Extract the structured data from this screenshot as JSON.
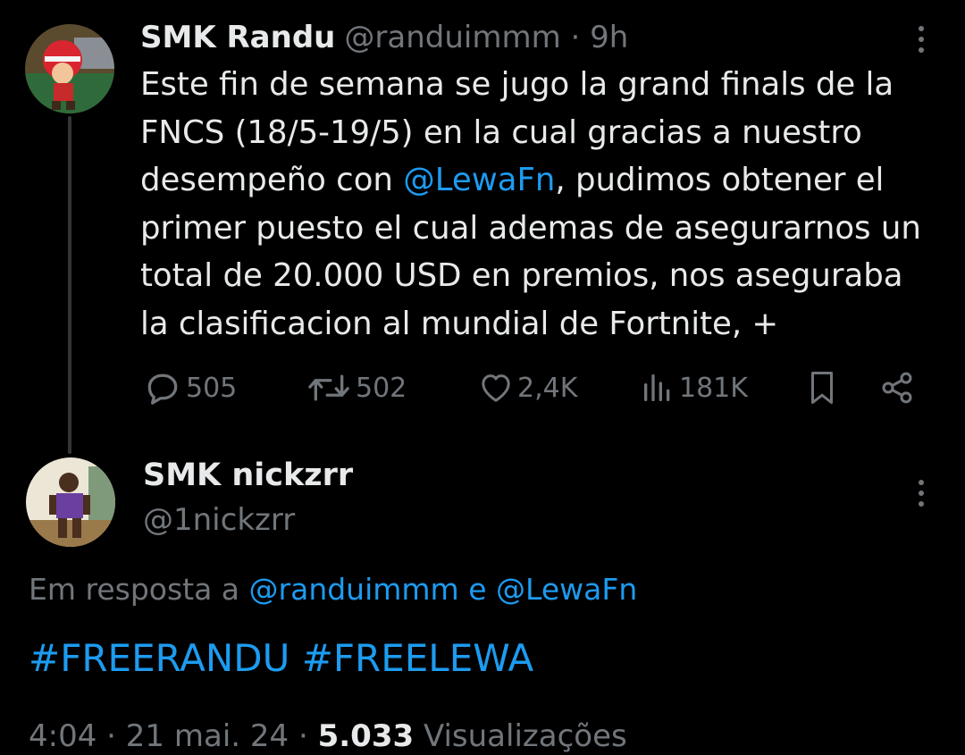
{
  "colors": {
    "background": "#000000",
    "text_primary": "#e7e9ea",
    "text_secondary": "#71767b",
    "accent": "#1d9bf0",
    "thread_line": "#333639"
  },
  "tweet1": {
    "author_name": "SMK Randu",
    "handle_time": "@randuimmm · 9h",
    "text_lines": {
      "l1": "Este fin de semana se jugo la grand finals de la",
      "l2": "FNCS (18/5-19/5) en la cual gracias a nuestro",
      "l3_before": "desempeño con ",
      "l3_mention": "@LewaFn",
      "l3_after": ", pudimos obtener el",
      "l4": "primer puesto el cual ademas de asegurarnos un",
      "l5": "total de 20.000 USD en premios, nos aseguraba",
      "l6": "la clasificacion al mundial de Fortnite, +"
    },
    "actions": {
      "replies": "505",
      "retweets": "502",
      "likes": "2,4K",
      "views": "181K"
    },
    "icons": [
      "reply-icon",
      "retweet-icon",
      "like-icon",
      "views-icon",
      "bookmark-icon",
      "share-icon",
      "more-icon"
    ]
  },
  "tweet2": {
    "author_name": "SMK nickzrr",
    "handle": "@1nickzrr",
    "reply_prefix": "Em resposta a ",
    "reply_mention1": "@randuimmm",
    "reply_conj": " e ",
    "reply_mention2": "@LewaFn",
    "hashtag1": "#FREERANDU",
    "hashtag2": "#FREELEWA",
    "time": "4:04",
    "date": "21 mai. 24",
    "views_count": "5.033",
    "views_label": "Visualizações"
  }
}
